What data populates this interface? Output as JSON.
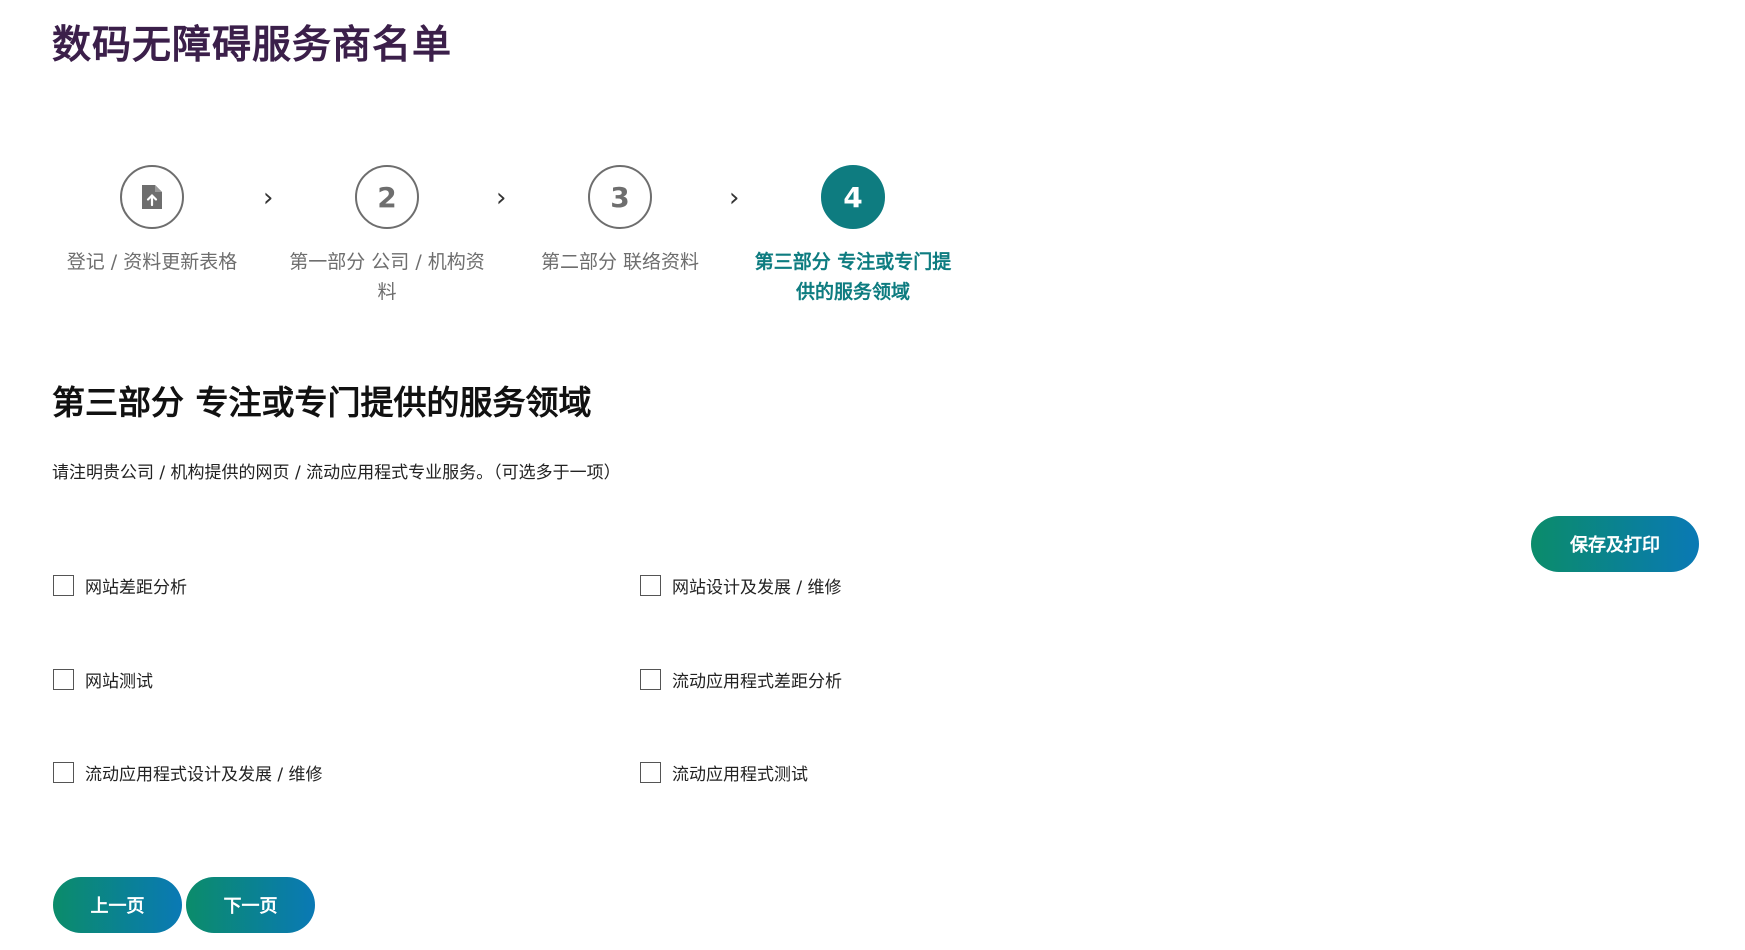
{
  "page": {
    "title": "数码无障碍服务商名单"
  },
  "stepper": {
    "steps": [
      {
        "number": "",
        "label": "登记 / 资料更新表格",
        "icon": "file-upload-icon",
        "active": false
      },
      {
        "number": "2",
        "label": "第一部分 公司 / 机构资料",
        "active": false
      },
      {
        "number": "3",
        "label": "第二部分 联络资料",
        "active": false
      },
      {
        "number": "4",
        "label": "第三部分 专注或专门提供的服务领域",
        "active": true
      }
    ],
    "separator": "›"
  },
  "section": {
    "title": "第三部分 专注或专门提供的服务领域",
    "instruction": "请注明贵公司 / 机构提供的网页 / 流动应用程式专业服务。（可选多于一项）"
  },
  "options": [
    {
      "label": "网站差距分析",
      "checked": false
    },
    {
      "label": "网站设计及发展 / 维修",
      "checked": false
    },
    {
      "label": "网站测试",
      "checked": false
    },
    {
      "label": "流动应用程式差距分析",
      "checked": false
    },
    {
      "label": "流动应用程式设计及发展 / 维修",
      "checked": false
    },
    {
      "label": "流动应用程式测试",
      "checked": false
    }
  ],
  "buttons": {
    "save_print": "保存及打印",
    "prev": "上一页",
    "next": "下一页"
  },
  "colors": {
    "title": "#3b1f4a",
    "accent": "#0e7c80",
    "button_gradient_start": "#0b8c6a",
    "button_gradient_end": "#0a79b5"
  }
}
